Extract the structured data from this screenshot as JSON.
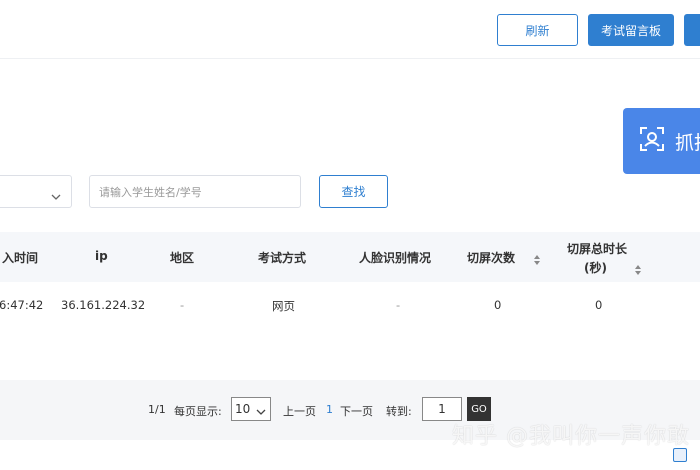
{
  "toolbar": {
    "refresh_label": "刷新",
    "message_board_label": "考试留言板"
  },
  "capture": {
    "label": "抓拍"
  },
  "filters": {
    "search_placeholder": "请输入学生姓名/学号",
    "find_label": "查找"
  },
  "table": {
    "headers": {
      "entry_time": "入时间",
      "ip": "ip",
      "region": "地区",
      "exam_mode": "考试方式",
      "face_status": "人脸识别情况",
      "switch_count": "切屏次数",
      "switch_total_line1": "切屏总时长",
      "switch_total_line2": "(秒)"
    },
    "rows": [
      {
        "entry_time": "6:47:42",
        "ip": "36.161.224.32",
        "region": "-",
        "exam_mode": "网页",
        "face_status": "-",
        "switch_count": "0",
        "switch_total": "0"
      }
    ]
  },
  "pagination": {
    "page_info": "1/1",
    "per_page_label": "每页显示:",
    "per_page_value": "10",
    "prev_label": "上一页",
    "current_page": "1",
    "next_label": "下一页",
    "jump_label": "转到:",
    "jump_value": "1",
    "go_label": "GO"
  },
  "watermark": {
    "text": "知乎 @我叫你一声你敢"
  },
  "colors": {
    "primary": "#2f7fd0",
    "capture_bg": "#4a86e8",
    "header_bg": "#f5f7fa"
  }
}
